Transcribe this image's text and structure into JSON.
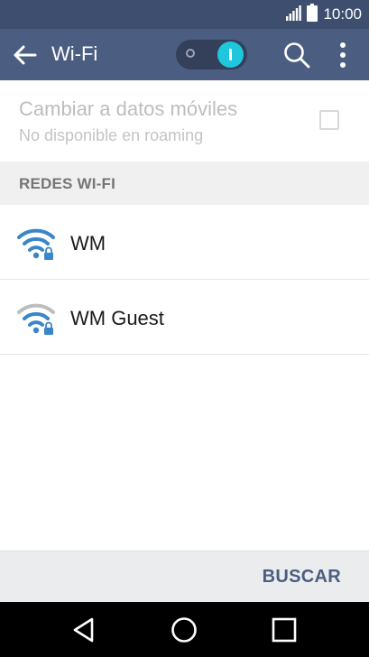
{
  "status_bar": {
    "time": "10:00",
    "signal_icon": "signal-bars-icon",
    "battery_icon": "battery-icon"
  },
  "action_bar": {
    "title": "Wi-Fi",
    "back_icon": "arrow-left-icon",
    "search_icon": "search-icon",
    "menu_icon": "more-vert-icon",
    "wifi_toggle_on": true
  },
  "mobile_data": {
    "title": "Cambiar a datos móviles",
    "subtitle": "No disponible en roaming",
    "checked": false
  },
  "section": {
    "title": "REDES WI-FI"
  },
  "networks": [
    {
      "name": "WM",
      "icon": "wifi-locked-icon",
      "signal": "full"
    },
    {
      "name": "WM Guest",
      "icon": "wifi-locked-icon",
      "signal": "partial"
    }
  ],
  "bottom_bar": {
    "scan_label": "BUSCAR"
  },
  "colors": {
    "status_bar": "#3d4e6e",
    "action_bar": "#4b5d80",
    "toggle_accent": "#1fc7dc",
    "wifi_blue": "#3a86c8"
  }
}
